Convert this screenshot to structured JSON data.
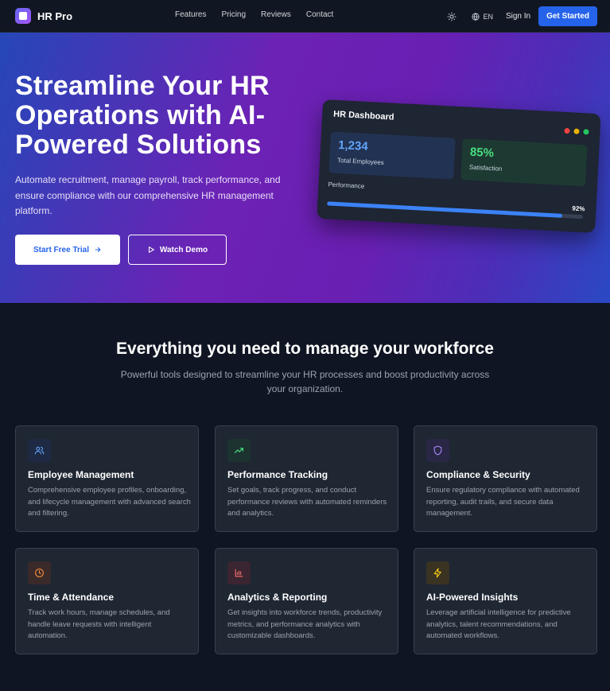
{
  "nav": {
    "brand": "HR Pro",
    "links": [
      "Features",
      "Pricing",
      "Reviews",
      "Contact"
    ],
    "language": "EN",
    "sign_in": "Sign In",
    "get_started": "Get Started"
  },
  "hero": {
    "headline": "Streamline Your HR Operations with AI-Powered Solutions",
    "description": "Automate recruitment, manage payroll, track performance, and ensure compliance with our comprehensive HR management platform.",
    "primary_cta": "Start Free Trial",
    "secondary_cta": "Watch Demo"
  },
  "dashboard": {
    "title": "HR Dashboard",
    "stats": [
      {
        "value": "1,234",
        "label": "Total Employees"
      },
      {
        "value": "85%",
        "label": "Satisfaction"
      }
    ],
    "performance_label": "Performance",
    "performance_value": "92%",
    "performance_fraction": 0.92
  },
  "features": {
    "title": "Everything you need to manage your workforce",
    "subtitle": "Powerful tools designed to streamline your HR processes and boost productivity across your organization.",
    "items": [
      {
        "title": "Employee Management",
        "description": "Comprehensive employee profiles, onboarding, and lifecycle management with advanced search and filtering.",
        "icon": "users-icon",
        "color": "#60a5fa"
      },
      {
        "title": "Performance Tracking",
        "description": "Set goals, track progress, and conduct performance reviews with automated reminders and analytics.",
        "icon": "trending-up-icon",
        "color": "#4ade80"
      },
      {
        "title": "Compliance & Security",
        "description": "Ensure regulatory compliance with automated reporting, audit trails, and secure data management.",
        "icon": "shield-icon",
        "color": "#a78bfa"
      },
      {
        "title": "Time & Attendance",
        "description": "Track work hours, manage schedules, and handle leave requests with intelligent automation.",
        "icon": "clock-icon",
        "color": "#fb923c"
      },
      {
        "title": "Analytics & Reporting",
        "description": "Get insights into workforce trends, productivity metrics, and performance analytics with customizable dashboards.",
        "icon": "bar-chart-icon",
        "color": "#f87171"
      },
      {
        "title": "AI-Powered Insights",
        "description": "Leverage artificial intelligence for predictive analytics, talent recommendations, and automated workflows.",
        "icon": "lightning-icon",
        "color": "#facc15"
      }
    ]
  }
}
